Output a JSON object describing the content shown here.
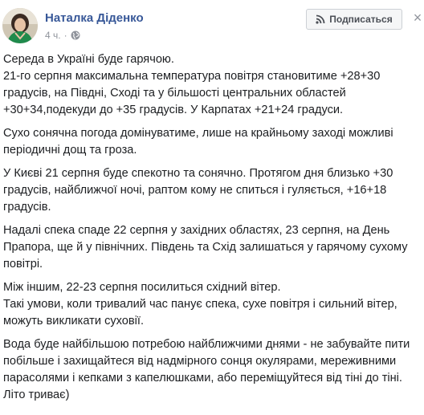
{
  "post": {
    "author": "Наталка Діденко",
    "time": "4 ч.",
    "dot": "·",
    "privacy_icon": "globe-icon",
    "subscribe_icon": "rss-icon",
    "subscribe_label": "Подписаться",
    "close_label": "×",
    "paragraphs": [
      "Середа в Україні буде гарячою.\n21-го серпня максимальна температура повітря становитиме +28+30 градусів, на Півдні, Сході та у більшості центральних областей +30+34,подекуди до +35 градусів. У Карпатах +21+24 градуси.",
      "Сухо сонячна погода домінуватиме, лише на крайньому заході можливі періодичні дощ та гроза.",
      "У Києві 21 серпня буде спекотно та сонячно. Протягом дня близько +30 градусів, найближчої ночі, раптом кому не спиться і гуляється, +16+18 градусів.",
      "Надалі спека спаде 22 серпня у західних областях, 23 серпня, на День Прапора, ще й у північних. Південь та Схід залишаться у гарячому сухому повітрі.",
      "Між іншим, 22-23 серпня посилиться східний вітер.\nТакі умови, коли тривалий час панує спека, сухе повітря і сильний вітер, можуть викликати суховії.",
      "Вода буде найбільшою потребою найближчими днями - не забувайте пити побільше і захищайтеся від надмірного сонця окулярами, мереживними парасолями і кепками з капелюшками, або переміщуйтеся від тіні до тіні.\nЛіто триває)"
    ]
  }
}
